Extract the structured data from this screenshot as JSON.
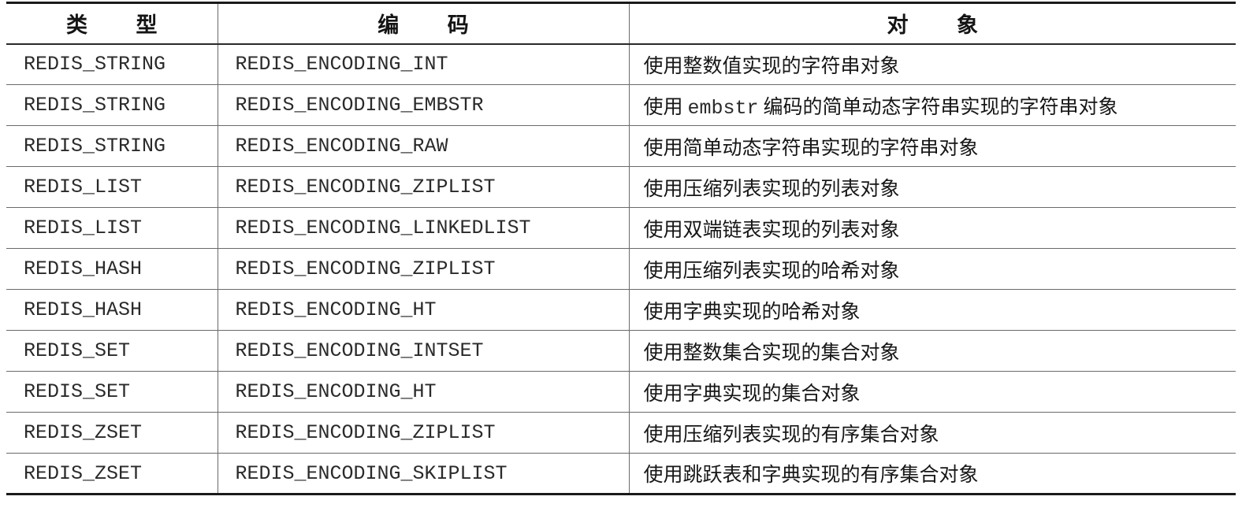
{
  "table": {
    "headers": [
      "类 型",
      "编 码",
      "对 象"
    ],
    "rows": [
      {
        "type": "REDIS_STRING",
        "encoding": "REDIS_ENCODING_INT",
        "object": "使用整数值实现的字符串对象"
      },
      {
        "type": "REDIS_STRING",
        "encoding": "REDIS_ENCODING_EMBSTR",
        "object_prefix": "使用",
        "object_code": "embstr",
        "object_suffix": "编码的简单动态字符串实现的字符串对象"
      },
      {
        "type": "REDIS_STRING",
        "encoding": "REDIS_ENCODING_RAW",
        "object": "使用简单动态字符串实现的字符串对象"
      },
      {
        "type": "REDIS_LIST",
        "encoding": "REDIS_ENCODING_ZIPLIST",
        "object": "使用压缩列表实现的列表对象"
      },
      {
        "type": "REDIS_LIST",
        "encoding": "REDIS_ENCODING_LINKEDLIST",
        "object": "使用双端链表实现的列表对象"
      },
      {
        "type": "REDIS_HASH",
        "encoding": "REDIS_ENCODING_ZIPLIST",
        "object": "使用压缩列表实现的哈希对象"
      },
      {
        "type": "REDIS_HASH",
        "encoding": "REDIS_ENCODING_HT",
        "object": "使用字典实现的哈希对象"
      },
      {
        "type": "REDIS_SET",
        "encoding": "REDIS_ENCODING_INTSET",
        "object": "使用整数集合实现的集合对象"
      },
      {
        "type": "REDIS_SET",
        "encoding": "REDIS_ENCODING_HT",
        "object": "使用字典实现的集合对象"
      },
      {
        "type": "REDIS_ZSET",
        "encoding": "REDIS_ENCODING_ZIPLIST",
        "object": "使用压缩列表实现的有序集合对象"
      },
      {
        "type": "REDIS_ZSET",
        "encoding": "REDIS_ENCODING_SKIPLIST",
        "object": "使用跳跃表和字典实现的有序集合对象"
      }
    ]
  }
}
